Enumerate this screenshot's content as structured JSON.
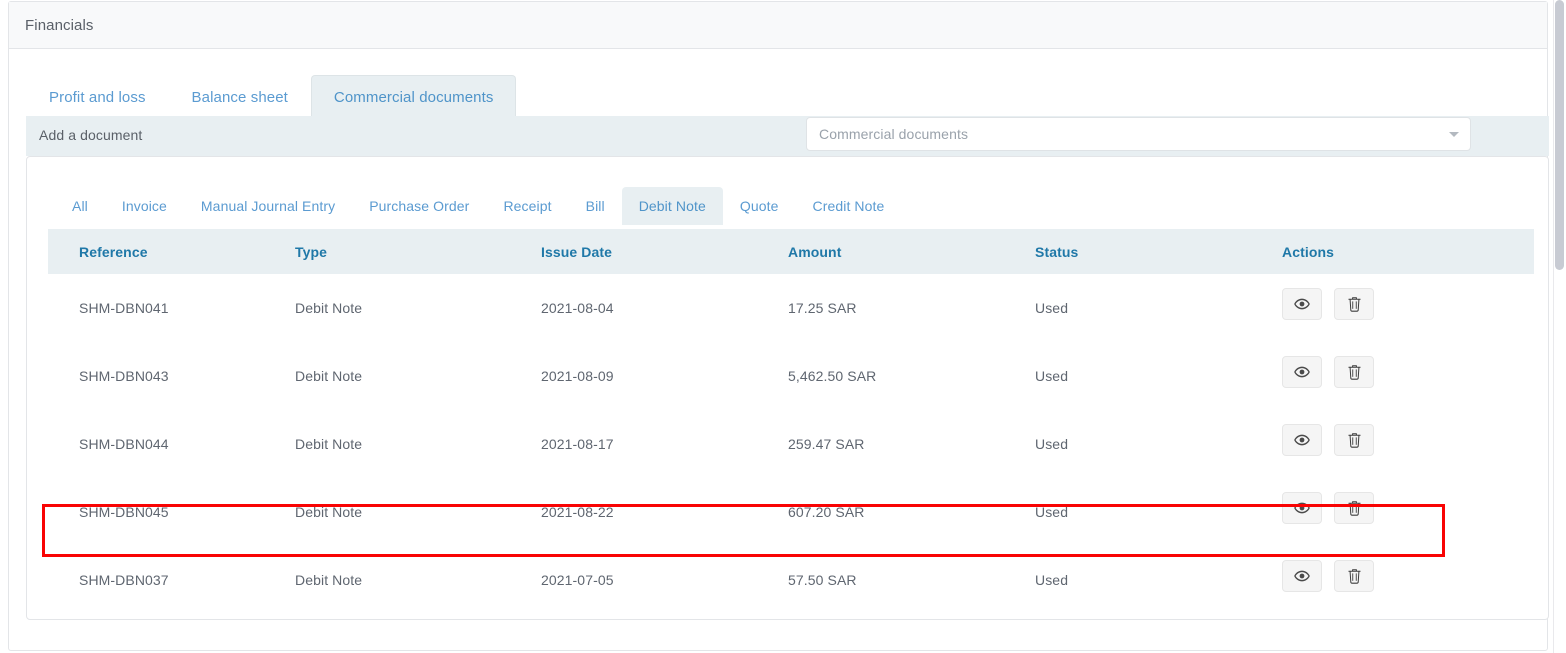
{
  "header": {
    "title": "Financials"
  },
  "top_tabs": [
    {
      "label": "Profit and loss",
      "active": false
    },
    {
      "label": "Balance sheet",
      "active": false
    },
    {
      "label": "Commercial documents",
      "active": true
    }
  ],
  "add_document": {
    "label": "Add a document",
    "select": {
      "value": "Commercial documents",
      "arrow_icon": "chevron-down-icon"
    }
  },
  "sub_tabs": [
    {
      "label": "All",
      "active": false
    },
    {
      "label": "Invoice",
      "active": false
    },
    {
      "label": "Manual Journal Entry",
      "active": false
    },
    {
      "label": "Purchase Order",
      "active": false
    },
    {
      "label": "Receipt",
      "active": false
    },
    {
      "label": "Bill",
      "active": false
    },
    {
      "label": "Debit Note",
      "active": true
    },
    {
      "label": "Quote",
      "active": false
    },
    {
      "label": "Credit Note",
      "active": false
    }
  ],
  "table": {
    "columns": [
      "Reference",
      "Type",
      "Issue Date",
      "Amount",
      "Status",
      "Actions"
    ],
    "rows": [
      {
        "reference": "SHM-DBN041",
        "type": "Debit Note",
        "issue_date": "2021-08-04",
        "amount": "17.25 SAR",
        "status": "Used",
        "highlighted": false
      },
      {
        "reference": "SHM-DBN043",
        "type": "Debit Note",
        "issue_date": "2021-08-09",
        "amount": "5,462.50 SAR",
        "status": "Used",
        "highlighted": false
      },
      {
        "reference": "SHM-DBN044",
        "type": "Debit Note",
        "issue_date": "2021-08-17",
        "amount": "259.47 SAR",
        "status": "Used",
        "highlighted": false
      },
      {
        "reference": "SHM-DBN045",
        "type": "Debit Note",
        "issue_date": "2021-08-22",
        "amount": "607.20 SAR",
        "status": "Used",
        "highlighted": false
      },
      {
        "reference": "SHM-DBN037",
        "type": "Debit Note",
        "issue_date": "2021-07-05",
        "amount": "57.50 SAR",
        "status": "Used",
        "highlighted": true
      }
    ],
    "action_icons": {
      "view": "eye-icon",
      "delete": "trash-icon"
    }
  },
  "colors": {
    "accent_blue": "#1f78a8",
    "link_blue": "#5b9bd1",
    "tab_active_bg": "#e8eff2",
    "header_bg": "#f8f9fa",
    "highlight_red": "#f90303",
    "text_gray": "#5f6670"
  }
}
